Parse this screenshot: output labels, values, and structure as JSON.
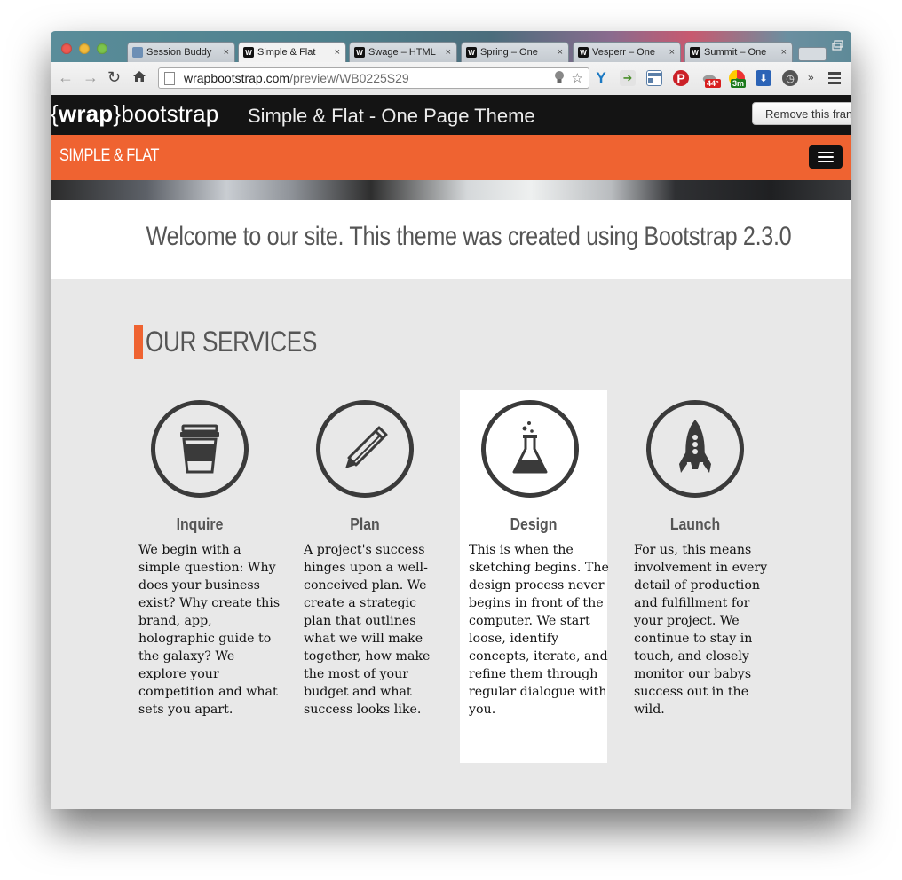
{
  "browser": {
    "tabs": [
      {
        "label": "Session Buddy",
        "favicon": "session-buddy",
        "active": false
      },
      {
        "label": "Simple & Flat",
        "favicon": "w",
        "active": true
      },
      {
        "label": "Swage – HTML",
        "favicon": "w",
        "active": false
      },
      {
        "label": "Spring – One",
        "favicon": "w",
        "active": false
      },
      {
        "label": "Vesperr – One",
        "favicon": "w",
        "active": false
      },
      {
        "label": "Summit – One",
        "favicon": "w",
        "active": false
      }
    ],
    "tab_close_glyph": "×",
    "url_host": "wrapbootstrap.com",
    "url_path": "/preview/WB0225S29",
    "badges": {
      "weather": "44°",
      "timer": "3m"
    }
  },
  "wrap_bar": {
    "logo_open": "{",
    "logo_word": "wrap",
    "logo_close": "}",
    "logo_tail": "bootstrap",
    "title": "Simple & Flat - One Page Theme",
    "remove_button": "Remove this frame"
  },
  "site": {
    "brand": "SIMPLE & FLAT",
    "welcome": "Welcome to our site. This theme was created using Bootstrap 2.3.0",
    "services_title": "OUR SERVICES",
    "accent_color": "#ef6331",
    "services": [
      {
        "title": "Inquire",
        "icon": "coffee-cup-icon",
        "text": "We begin with a simple question: Why does your business exist? Why create this brand, app, holographic guide to the galaxy? We explore your competition and what sets you apart."
      },
      {
        "title": "Plan",
        "icon": "pencil-icon",
        "text": "A project's success hinges upon a well-conceived plan. We create a strategic plan that outlines what we will make together, how make the most of your budget and what success looks like."
      },
      {
        "title": "Design",
        "icon": "flask-icon",
        "text": "This is when the sketching begins. The design process never begins in front of the computer. We start loose, identify concepts, iterate, and refine them through regular dialogue with you."
      },
      {
        "title": "Launch",
        "icon": "rocket-icon",
        "text": "For us, this means involvement in every detail of production and fulfillment for your project. We continue to stay in touch, and closely monitor our babys success out in the wild."
      }
    ]
  }
}
